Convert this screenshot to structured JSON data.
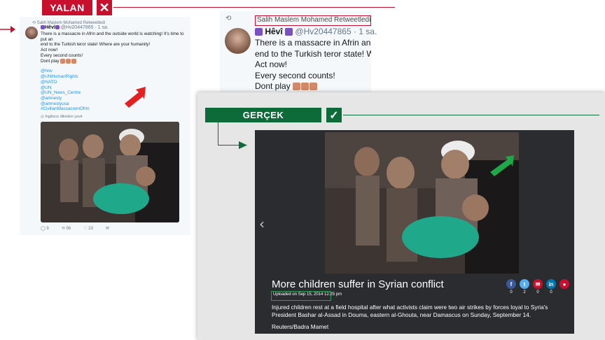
{
  "verdict_false": {
    "label": "YALAN",
    "icon": "close-icon"
  },
  "verdict_true": {
    "label": "GERÇEK",
    "icon": "check-icon"
  },
  "tweet": {
    "retweet_line": "Salih Maslem Mohamed Retweetledi",
    "display_name": "Hêvî",
    "handle": "@Hv20447865 · 1 sa.",
    "text_line1": "There is a massacre in Afrin and the outside world is watching! It's time to put an",
    "text_line2": "end to the Turkish teror state! Where are your humanity!",
    "text_line3": "Act now!",
    "text_line4": "Every second counts!",
    "text_line5": "Dont play",
    "mentions": [
      "@hrw",
      "@UNHumanRights",
      "@NATO",
      "@UN",
      "@UN_News_Centre",
      "@amnesty",
      "@amnestyusa",
      "#CivilianMassacreinOfrin"
    ],
    "translate": "İngilizce dilinden çevir",
    "replies": "9",
    "retweets": "56",
    "likes": "23"
  },
  "zoom": {
    "retweet_line": "Salih Maslem Mohamed Retweetledi",
    "display_name": "Hêvî",
    "handle": "@Hv20447865 · 1 sa.",
    "line1": "There is a massacre in Afrin and th",
    "line2": "end to the Turkish teror state! Whe",
    "line3": "Act now!",
    "line4": "Every second counts!",
    "line5": "Dont play"
  },
  "article": {
    "title": "More children suffer in Syrian conflict",
    "uploaded": "Uploaded on Sep 15, 2014 12:25 pm",
    "caption": "Injured children rest at a field hospital after what activists claim were two air strikes by forces loyal to Syria's President Bashar al-Assad in Douma, eastern al-Ghouta, near Damascus on Sunday, September 14.",
    "credit": "Reuters/Badra Mamet",
    "share": [
      {
        "icon": "facebook-icon",
        "glyph": "f",
        "color": "#3b5998",
        "count": "0"
      },
      {
        "icon": "twitter-icon",
        "glyph": "t",
        "color": "#55acee",
        "count": "2"
      },
      {
        "icon": "mail-icon",
        "glyph": "✉",
        "color": "#c8102e",
        "count": "0"
      },
      {
        "icon": "linkedin-icon",
        "glyph": "in",
        "color": "#0077b5",
        "count": "0"
      },
      {
        "icon": "comment-icon",
        "glyph": "●",
        "color": "#c8102e",
        "count": ""
      }
    ]
  },
  "colors": {
    "false_red": "#c8102e",
    "true_green": "#0d6b3a",
    "twitter_blue": "#1b95e0"
  }
}
